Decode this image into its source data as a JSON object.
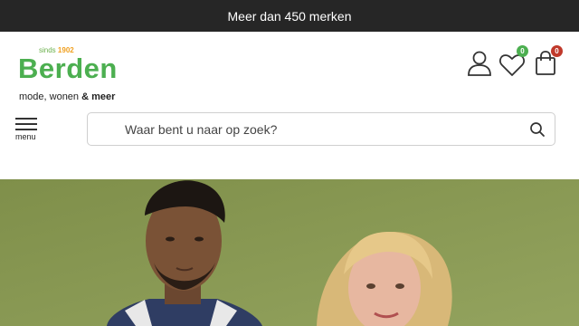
{
  "announcement": "Meer dan 450 merken",
  "logo": {
    "since_label": "sinds",
    "since_year": "1902",
    "brand": "Berden",
    "tagline_a": "mode, wonen",
    "tagline_amp": "&",
    "tagline_b": "meer"
  },
  "header": {
    "account_icon": "user-icon",
    "wishlist_count": "0",
    "cart_count": "0"
  },
  "menu": {
    "label": "menu"
  },
  "search": {
    "placeholder": "Waar bent u naar op zoek?"
  },
  "colors": {
    "brand_green": "#4caf50",
    "wishlist_badge": "#4caf50",
    "cart_badge": "#c0392b",
    "topbar": "#262626"
  },
  "hero": {
    "description_visible": false
  }
}
